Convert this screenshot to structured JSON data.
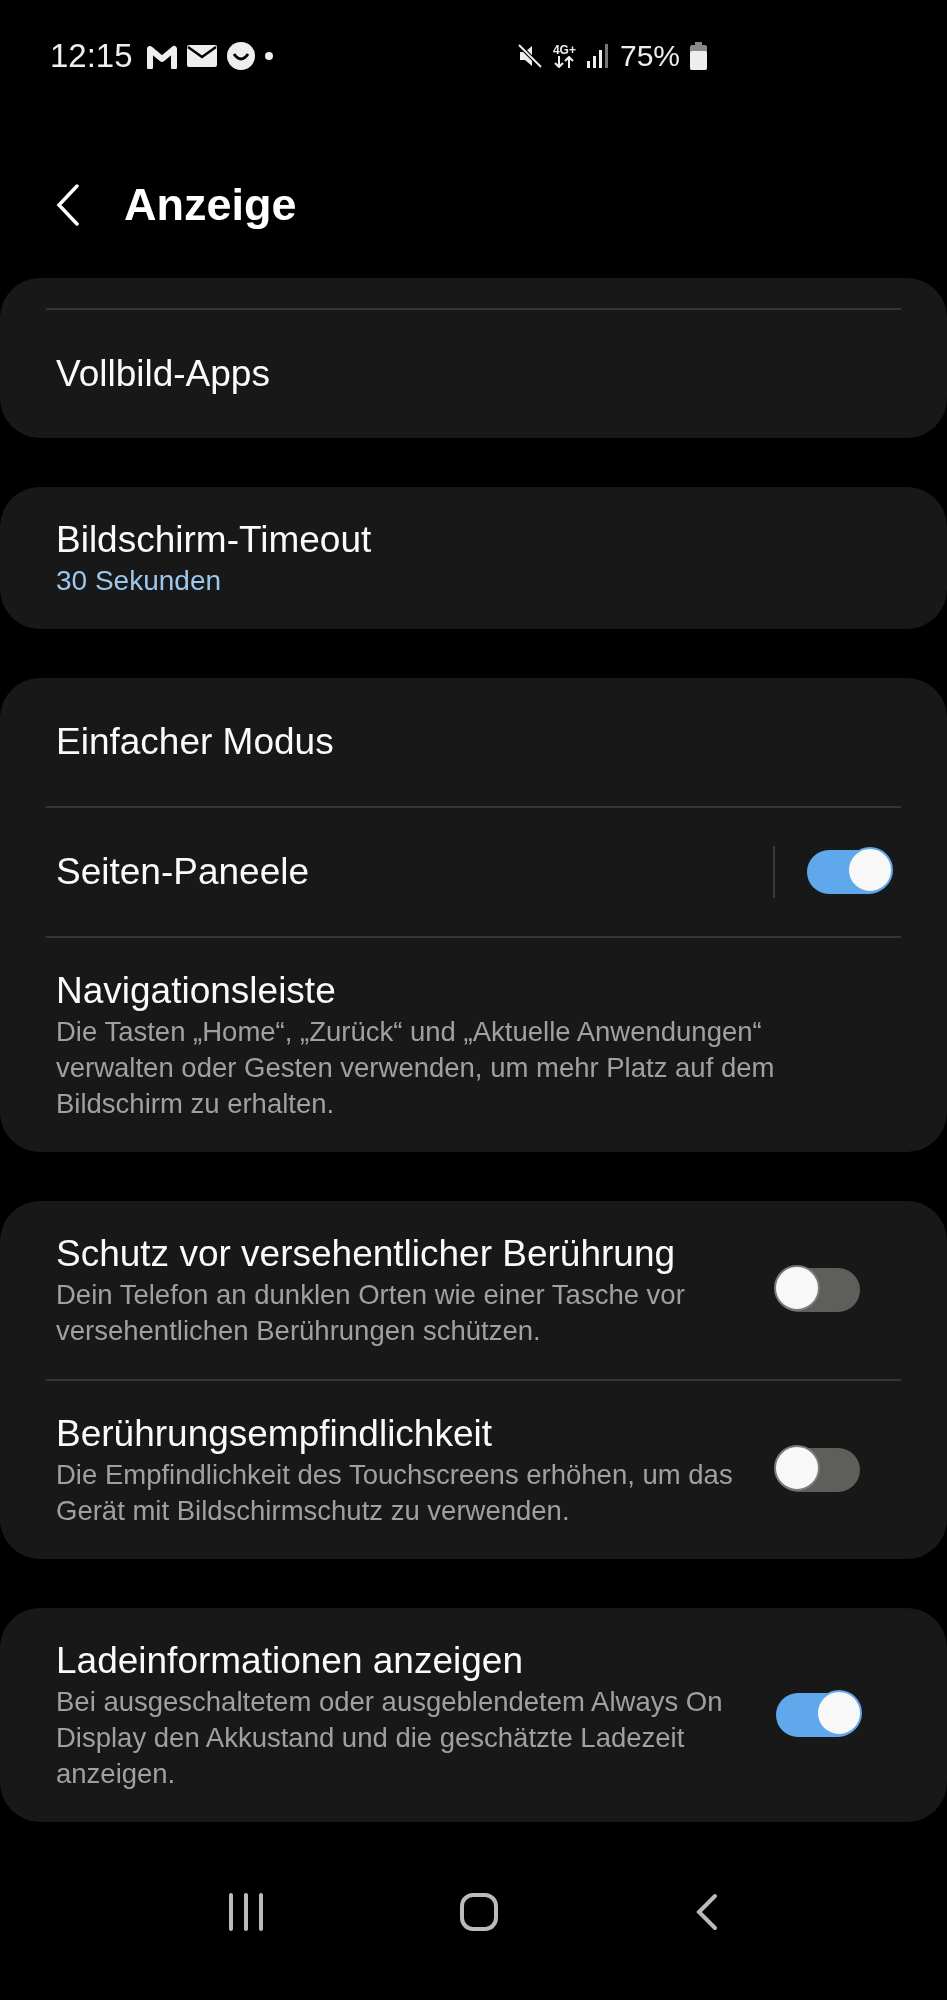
{
  "status_bar": {
    "time": "12:15",
    "network": "4G+",
    "battery": "75%"
  },
  "header": {
    "title": "Anzeige"
  },
  "cards": [
    {
      "top_rule": true,
      "items": [
        {
          "kind": "link",
          "title": "Vollbild-Apps"
        }
      ]
    },
    {
      "items": [
        {
          "kind": "link",
          "title": "Bildschirm-Timeout",
          "value": "30 Sekunden"
        }
      ]
    },
    {
      "items": [
        {
          "kind": "link",
          "title": "Einfacher Modus"
        },
        {
          "kind": "switch",
          "title": "Seiten-Paneele",
          "separator": true,
          "on": true
        },
        {
          "kind": "link",
          "title": "Navigationsleiste",
          "description": "Die Tasten „Home“, „Zurück“ und „Aktuelle Anwendungen“ verwalten oder Gesten verwenden, um mehr Platz auf dem Bildschirm zu erhalten."
        }
      ]
    },
    {
      "items": [
        {
          "kind": "switch",
          "title": "Schutz vor versehentlicher Berührung",
          "description": "Dein Telefon an dunklen Orten wie einer Tasche vor versehentlichen Berührungen schützen.",
          "on": false
        },
        {
          "kind": "switch",
          "title": "Berührungsempfindlichkeit",
          "description": "Die Empfindlichkeit des Touchscreens erhöhen, um das Gerät mit Bildschirmschutz zu verwenden.",
          "on": false
        }
      ]
    },
    {
      "items": [
        {
          "kind": "switch",
          "title": "Ladeinformationen anzeigen",
          "description": "Bei ausgeschaltetem oder ausgeblendetem Always On Display den Akkustand und die geschätzte Ladezeit anzeigen.",
          "on": true
        }
      ]
    }
  ]
}
